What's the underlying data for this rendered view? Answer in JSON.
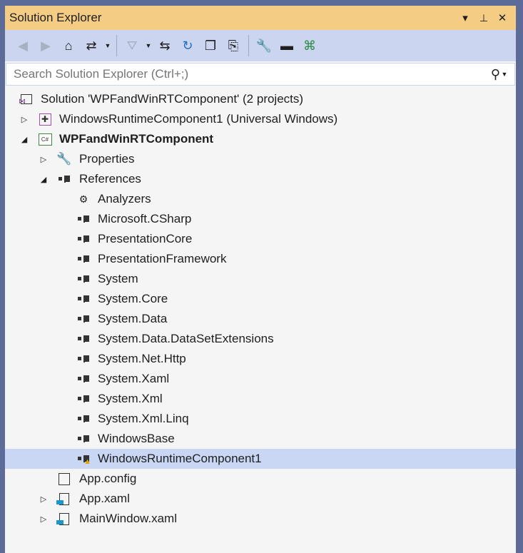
{
  "title": "Solution Explorer",
  "title_buttons": {
    "dropdown": "▾",
    "pin": "📌",
    "close": "✕"
  },
  "toolbar": [
    {
      "name": "back-button",
      "icon": "◀",
      "disabled": true
    },
    {
      "name": "forward-button",
      "icon": "▶",
      "disabled": true
    },
    {
      "name": "home-button",
      "icon": "⌂"
    },
    {
      "name": "switch-views-button",
      "icon": "⇄",
      "dropdown": true
    },
    {
      "sep": true
    },
    {
      "name": "pending-changes-filter-button",
      "icon": "⛛",
      "disabled": true,
      "dropdown": true
    },
    {
      "name": "sync-with-active-document-button",
      "icon": "⇆"
    },
    {
      "name": "refresh-button",
      "icon": "↻",
      "color": "#1e6fc8"
    },
    {
      "name": "collapse-all-button",
      "icon": "❐"
    },
    {
      "name": "show-all-files-button",
      "icon": "⎘"
    },
    {
      "sep": true
    },
    {
      "name": "properties-button",
      "icon": "🔧"
    },
    {
      "name": "preview-selected-items-button",
      "icon": "▬"
    },
    {
      "name": "view-class-diagram-button",
      "icon": "⌘",
      "color": "#2b8a3e"
    }
  ],
  "search": {
    "placeholder": "Search Solution Explorer (Ctrl+;)"
  },
  "tree": [
    {
      "label": "Solution 'WPFandWinRTComponent' (2 projects)",
      "level": 0,
      "expander": "",
      "icon": "solution"
    },
    {
      "label": "WindowsRuntimeComponent1 (Universal Windows)",
      "level": 1,
      "expander": "▷",
      "icon": "uwp-project"
    },
    {
      "label": "WPFandWinRTComponent",
      "level": 1,
      "expander": "◢",
      "icon": "csharp-project",
      "bold": true
    },
    {
      "label": "Properties",
      "level": 2,
      "expander": "▷",
      "icon": "wrench"
    },
    {
      "label": "References",
      "level": 2,
      "expander": "◢",
      "icon": "reference"
    },
    {
      "label": "Analyzers",
      "level": 3,
      "icon": "analyzer"
    },
    {
      "label": "Microsoft.CSharp",
      "level": 3,
      "icon": "reference"
    },
    {
      "label": "PresentationCore",
      "level": 3,
      "icon": "reference"
    },
    {
      "label": "PresentationFramework",
      "level": 3,
      "icon": "reference"
    },
    {
      "label": "System",
      "level": 3,
      "icon": "reference"
    },
    {
      "label": "System.Core",
      "level": 3,
      "icon": "reference"
    },
    {
      "label": "System.Data",
      "level": 3,
      "icon": "reference"
    },
    {
      "label": "System.Data.DataSetExtensions",
      "level": 3,
      "icon": "reference"
    },
    {
      "label": "System.Net.Http",
      "level": 3,
      "icon": "reference"
    },
    {
      "label": "System.Xaml",
      "level": 3,
      "icon": "reference"
    },
    {
      "label": "System.Xml",
      "level": 3,
      "icon": "reference"
    },
    {
      "label": "System.Xml.Linq",
      "level": 3,
      "icon": "reference"
    },
    {
      "label": "WindowsBase",
      "level": 3,
      "icon": "reference"
    },
    {
      "label": "WindowsRuntimeComponent1",
      "level": 3,
      "icon": "reference-warning",
      "selected": true
    },
    {
      "label": "App.config",
      "level": 2,
      "icon": "config"
    },
    {
      "label": "App.xaml",
      "level": 2,
      "expander": "▷",
      "icon": "xaml"
    },
    {
      "label": "MainWindow.xaml",
      "level": 2,
      "expander": "▷",
      "icon": "xaml"
    }
  ],
  "colors": {
    "title_bg": "#f5cc84",
    "toolbar_bg": "#ccd5f0",
    "selection": "#c9d7f5",
    "frame": "#5d6b99"
  }
}
